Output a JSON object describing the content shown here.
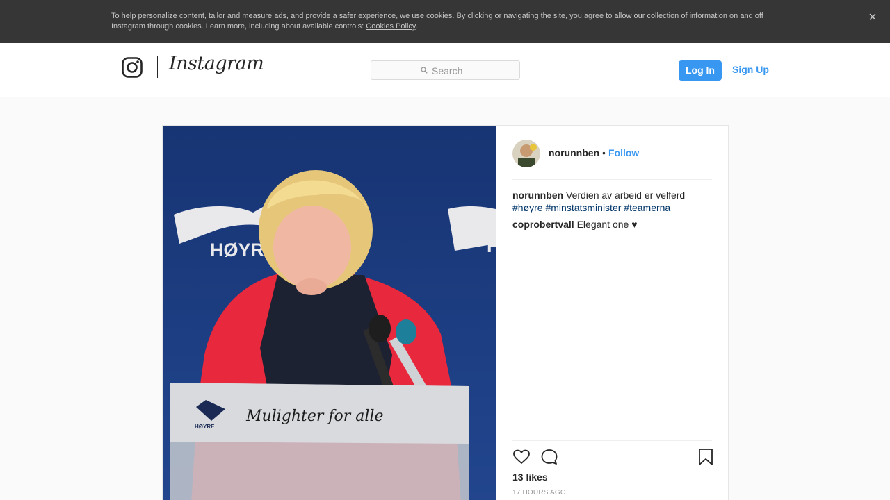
{
  "cookie_bar": {
    "text": "To help personalize content, tailor and measure ads, and provide a safer experience, we use cookies. By clicking or navigating the site, you agree to allow our collection of information on and off Instagram through cookies. Learn more, including about available controls: ",
    "link": "Cookies Policy",
    "trailing": ".",
    "close_icon": "close-icon"
  },
  "nav": {
    "wordmark": "Instagram",
    "logo_icon": "instagram-glyph-icon",
    "search_placeholder": "Search",
    "search_icon": "search-icon",
    "login_label": "Log In",
    "signup_label": "Sign Up"
  },
  "photo": {
    "backdrop_text": "HØYRE",
    "backdrop_text_right": "H",
    "podium_logo_text": "HØYRE",
    "podium_text": "Mulighter for alle"
  },
  "post": {
    "username": "norunnben",
    "dot": "•",
    "follow_label": "Follow",
    "caption": {
      "username": "norunnben",
      "text": "Verdien av arbeid er velferd",
      "hashtags": [
        "#høyre",
        "#minstatsminister",
        "#teamerna"
      ]
    },
    "comments": [
      {
        "username": "coprobertvall",
        "text": "Elegant one ♥"
      }
    ],
    "likes": "13 likes",
    "timestamp": "17 HOURS AGO",
    "icons": {
      "like": "heart-icon",
      "comment": "comment-icon",
      "save": "bookmark-icon"
    }
  },
  "colors": {
    "accent": "#3897f0",
    "cookie_bg": "#363636",
    "hashtag": "#003569"
  }
}
